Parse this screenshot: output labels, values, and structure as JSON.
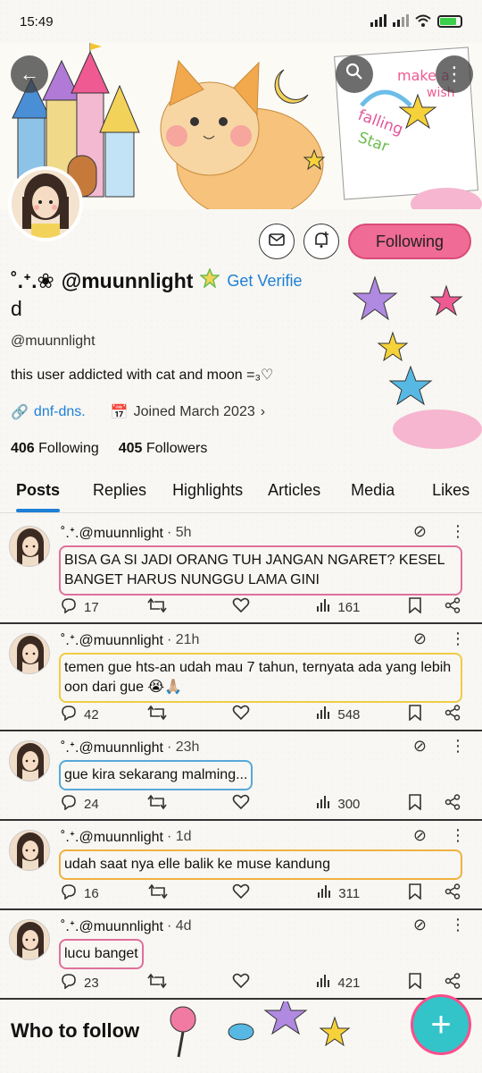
{
  "status": {
    "time": "15:49",
    "battery_level": 0.8
  },
  "profile": {
    "name_prefix": "˚.ᕀ.❀",
    "display_name": "@muunnlight",
    "verify_label": "Get Verifie",
    "verify_tail": "d",
    "handle": "@muunnlight",
    "bio": "this user addicted with cat and moon =₃♡",
    "link": "dnf-dns.",
    "joined": "Joined March 2023",
    "following_count": "406",
    "following_label": "Following",
    "followers_count": "405",
    "followers_label": "Followers"
  },
  "banner": {
    "wish_text_1": "make a",
    "wish_text_2": "wish",
    "falling_text_1": "falling",
    "falling_text_2": "Star"
  },
  "actions": {
    "follow_label": "Following"
  },
  "tabs": [
    {
      "label": "Posts",
      "active": true
    },
    {
      "label": "Replies"
    },
    {
      "label": "Highlights"
    },
    {
      "label": "Articles"
    },
    {
      "label": "Media"
    },
    {
      "label": "Likes"
    }
  ],
  "posts": [
    {
      "author": "˚.ᕀ.@muunnlight",
      "time": "· 5h",
      "text": "BISA GA SI JADI ORANG TUH JANGAN NGARET? KESEL BANGET HARUS NUNGGU LAMA GINI",
      "replies": "17",
      "views": "161",
      "outline": "#e0709c"
    },
    {
      "author": "˚.ᕀ.@muunnlight",
      "time": "· 21h",
      "text": "temen gue hts-an udah mau 7 tahun, ternyata ada yang lebih oon dari gue 😭🙏🏼",
      "replies": "42",
      "views": "548",
      "outline": "#f0cc45"
    },
    {
      "author": "˚.ᕀ.@muunnlight",
      "time": "· 23h",
      "text": "gue kira sekarang malming...",
      "replies": "24",
      "views": "300",
      "outline": "#57a8d8"
    },
    {
      "author": "˚.ᕀ.@muunnlight",
      "time": "· 1d",
      "text": "udah saat nya elle balik ke muse kandung",
      "replies": "16",
      "views": "311",
      "outline": "#f0b140"
    },
    {
      "author": "˚.ᕀ.@muunnlight",
      "time": "· 4d",
      "text": "lucu banget",
      "replies": "23",
      "views": "421",
      "outline": "#e0709c"
    }
  ],
  "who_to_follow": {
    "title": "Who to follow"
  },
  "colors": {
    "accent": "#1d7fd6",
    "follow_button": "#f06b96",
    "fab": "#33c4c9"
  }
}
